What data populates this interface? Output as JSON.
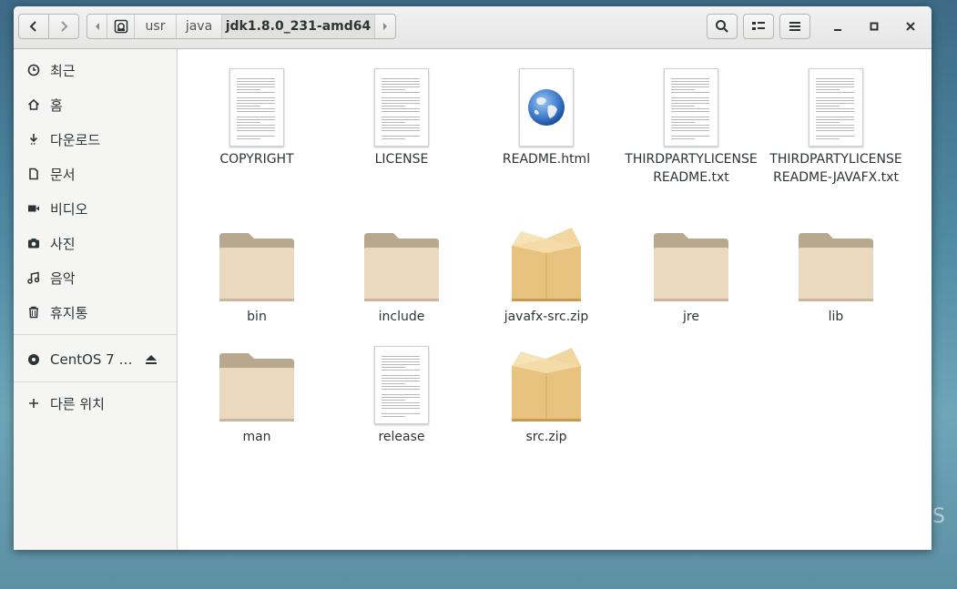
{
  "desktop": {
    "corner_text": "S"
  },
  "header": {
    "nav": {
      "back_icon": "go-back-icon",
      "forward_icon": "go-forward-icon"
    },
    "path": {
      "left_arrow": "◀",
      "right_arrow": "▶",
      "segments": [
        "usr",
        "java",
        "jdk1.8.0_231-amd64"
      ]
    },
    "tools": {
      "search_icon": "search-icon",
      "view_icon": "view-toggle-icon",
      "menu_icon": "menu-icon"
    },
    "window": {
      "minimize": "minimize-icon",
      "maximize": "maximize-icon",
      "close": "close-icon"
    }
  },
  "sidebar": {
    "items": [
      {
        "label": "최근",
        "icon": "clock-icon"
      },
      {
        "label": "홈",
        "icon": "home-icon"
      },
      {
        "label": "다운로드",
        "icon": "download-icon"
      },
      {
        "label": "문서",
        "icon": "document-icon"
      },
      {
        "label": "비디오",
        "icon": "video-icon"
      },
      {
        "label": "사진",
        "icon": "camera-icon"
      },
      {
        "label": "음악",
        "icon": "music-icon"
      },
      {
        "label": "휴지통",
        "icon": "trash-icon"
      }
    ],
    "device": {
      "label": "CentOS 7 …",
      "icon": "disc-icon",
      "eject_icon": "eject-icon"
    },
    "other": {
      "label": "다른 위치",
      "icon": "plus-icon"
    }
  },
  "files": [
    {
      "name": "COPYRIGHT",
      "type": "text"
    },
    {
      "name": "LICENSE",
      "type": "text"
    },
    {
      "name": "README.html",
      "type": "html"
    },
    {
      "name": "THIRDPARTYLICENSEREADME.txt",
      "type": "text"
    },
    {
      "name": "THIRDPARTYLICENSEREADME-JAVAFX.txt",
      "type": "text"
    },
    {
      "name": "bin",
      "type": "folder"
    },
    {
      "name": "include",
      "type": "folder"
    },
    {
      "name": "javafx-src.zip",
      "type": "archive"
    },
    {
      "name": "jre",
      "type": "folder"
    },
    {
      "name": "lib",
      "type": "folder"
    },
    {
      "name": "man",
      "type": "folder"
    },
    {
      "name": "release",
      "type": "text"
    },
    {
      "name": "src.zip",
      "type": "archive"
    }
  ]
}
